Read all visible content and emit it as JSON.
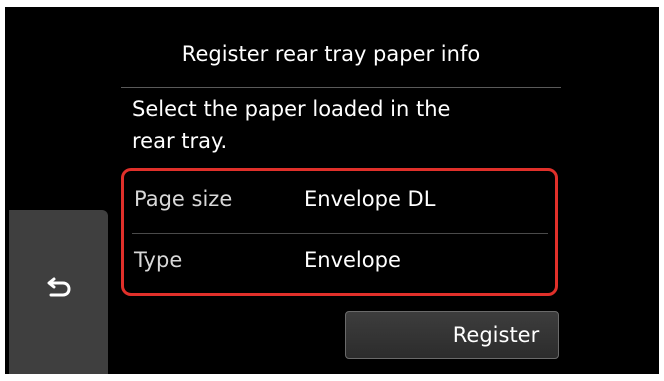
{
  "header": {
    "title": "Register rear tray paper info"
  },
  "message": {
    "line1": "Select the paper loaded in the",
    "line2": "rear tray."
  },
  "settings": {
    "rows": [
      {
        "label": "Page size",
        "value": "Envelope DL"
      },
      {
        "label": "Type",
        "value": "Envelope"
      }
    ]
  },
  "buttons": {
    "back_icon": "back-arrow-icon",
    "register_label": "Register"
  },
  "colors": {
    "screen_background": "#000000",
    "highlight_border": "#e0302a",
    "button_background": "#3f3f3f"
  }
}
